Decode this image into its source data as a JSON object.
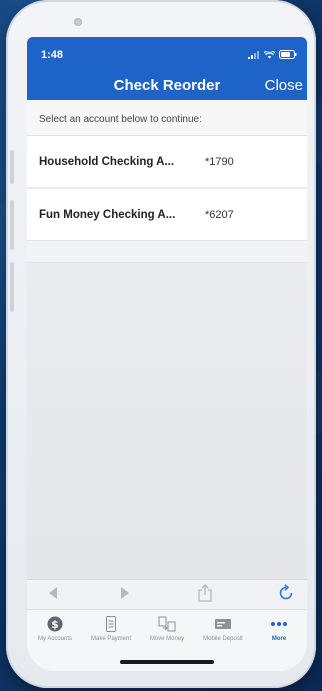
{
  "status_bar": {
    "time": "1:48"
  },
  "nav": {
    "title": "Check Reorder",
    "close_label": "Close"
  },
  "prompt": "Select an account below to continue:",
  "accounts": [
    {
      "name": "Household Checking A...",
      "number": "*1790"
    },
    {
      "name": "Fun Money Checking A...",
      "number": "*6207"
    }
  ],
  "browser_bar": {
    "icons": [
      "back-arrow-icon",
      "forward-arrow-icon",
      "share-icon",
      "refresh-icon"
    ]
  },
  "tabbar": {
    "tabs": [
      {
        "label": "My Accounts",
        "icon": "dollar-coin-icon"
      },
      {
        "label": "Make Payment",
        "icon": "bill-icon"
      },
      {
        "label": "Move Money",
        "icon": "transfer-icon"
      },
      {
        "label": "Mobile Deposit",
        "icon": "check-deposit-icon"
      },
      {
        "label": "More",
        "icon": "more-dots-icon",
        "selected": true
      }
    ]
  },
  "colors": {
    "brand_blue": "#1e63c8",
    "refresh_blue": "#2b7bd8"
  }
}
